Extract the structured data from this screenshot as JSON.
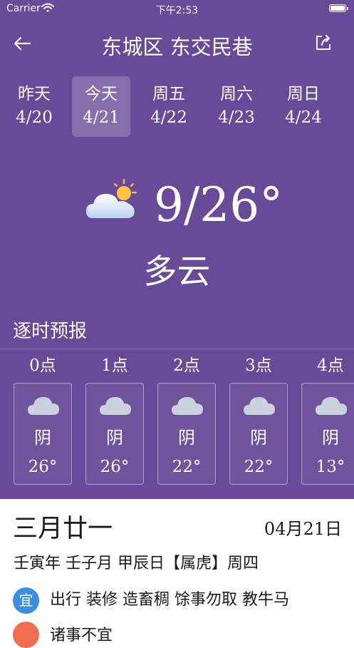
{
  "status_bar": {
    "carrier": "Carrier",
    "time": "下午2:53"
  },
  "header": {
    "title": "东城区 东交民巷"
  },
  "days": [
    {
      "name": "昨天",
      "date": "4/20"
    },
    {
      "name": "今天",
      "date": "4/21",
      "selected": true
    },
    {
      "name": "周五",
      "date": "4/22"
    },
    {
      "name": "周六",
      "date": "4/23"
    },
    {
      "name": "周日",
      "date": "4/24"
    }
  ],
  "current": {
    "icon": "partly-cloudy-icon",
    "temp": "9/26°",
    "desc": "多云"
  },
  "hourly": {
    "title": "逐时预报",
    "items": [
      {
        "hour": "0点",
        "weather": "阴",
        "temp": "26°",
        "icon": "cloud-icon"
      },
      {
        "hour": "1点",
        "weather": "阴",
        "temp": "26°",
        "icon": "cloud-icon"
      },
      {
        "hour": "2点",
        "weather": "阴",
        "temp": "22°",
        "icon": "cloud-icon"
      },
      {
        "hour": "3点",
        "weather": "阴",
        "temp": "22°",
        "icon": "cloud-icon"
      },
      {
        "hour": "4点",
        "weather": "阴",
        "temp": "13°",
        "icon": "cloud-icon"
      }
    ]
  },
  "almanac": {
    "lunar_date": "三月廿一",
    "gregorian_date": "04月21日",
    "ganzhi": "壬寅年 壬子月 甲辰日【属虎】周四",
    "yi_label": "宜",
    "yi_text": "出行 装修 造畜稠 馀事勿取 教牛马",
    "ji_text": "诸事不宜"
  },
  "colors": {
    "weather_bg": "#694a98",
    "yi_badge": "#3b8fe0",
    "ji_badge": "#f26d4f"
  }
}
